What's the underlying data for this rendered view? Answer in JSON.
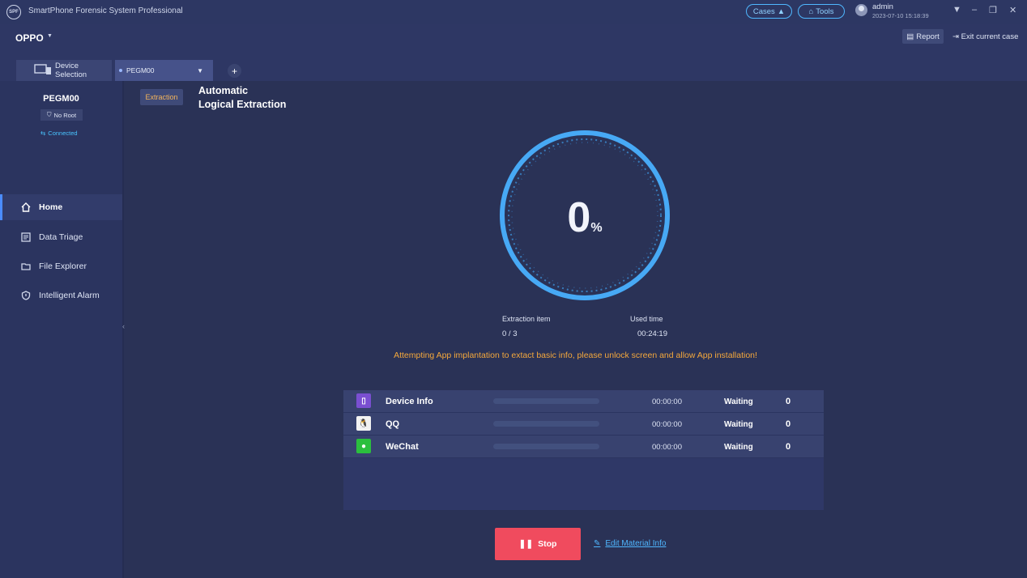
{
  "window": {
    "logo_text": "SPF",
    "app_title": "SmartPhone Forensic System Professional",
    "cases_label": "Cases",
    "tools_label": "Tools",
    "user": "admin",
    "datetime": "2023-07-10 15:18:39"
  },
  "subbar": {
    "brand": "OPPO",
    "report_label": "Report",
    "exit_label": "Exit current case",
    "device_selection_label": "Device Selection",
    "selected_device": "PEGM00"
  },
  "sidebar": {
    "device_name": "PEGM00",
    "root_status": "No Root",
    "connection": "Connected",
    "items": [
      {
        "label": "Home",
        "icon": "home-icon"
      },
      {
        "label": "Data Triage",
        "icon": "triage-icon"
      },
      {
        "label": "File Explorer",
        "icon": "folder-icon"
      },
      {
        "label": "Intelligent Alarm",
        "icon": "alarm-icon"
      }
    ]
  },
  "main": {
    "chip": "Extraction",
    "headline_line1": "Automatic",
    "headline_line2": "Logical Extraction",
    "progress_percent": 0,
    "progress_num": "0",
    "progress_sym": "%",
    "extraction_item_label": "Extraction item",
    "extraction_item_value": "0 / 3",
    "used_time_label": "Used time",
    "used_time_value": "00:24:19",
    "warning": "Attempting App implantation to extact basic info, please unlock screen and allow App installation!",
    "items": [
      {
        "name": "Device Info",
        "time": "00:00:00",
        "status": "Waiting",
        "count": "0",
        "progress": 0
      },
      {
        "name": "QQ",
        "time": "00:00:00",
        "status": "Waiting",
        "count": "0",
        "progress": 0
      },
      {
        "name": "WeChat",
        "time": "00:00:00",
        "status": "Waiting",
        "count": "0",
        "progress": 0
      }
    ],
    "stop_label": "Stop",
    "edit_label": "Edit Material Info"
  },
  "colors": {
    "accent": "#4fb7ff",
    "warning": "#f4a83c",
    "stop": "#f04b5e",
    "chip_text": "#f4b55b"
  }
}
